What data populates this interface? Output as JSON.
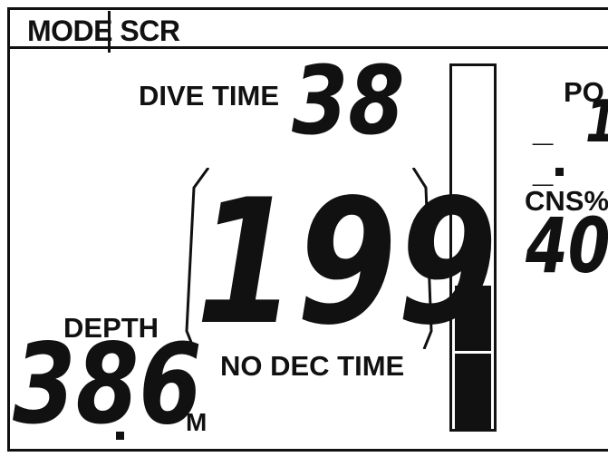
{
  "mode_bar": {
    "label": "MODE SCR"
  },
  "dive_time": {
    "label": "DIVE TIME",
    "value": "38"
  },
  "no_deco": {
    "value": "199",
    "label": "NO DEC TIME"
  },
  "depth": {
    "label": "DEPTH",
    "value": "386",
    "unit": "M"
  },
  "po2": {
    "label": "PO",
    "value": "1",
    "dashes": "_ _"
  },
  "cns": {
    "label": "CNS%",
    "value": "40"
  },
  "gauge": {
    "segments_filled": 2,
    "segments_total": 5
  }
}
